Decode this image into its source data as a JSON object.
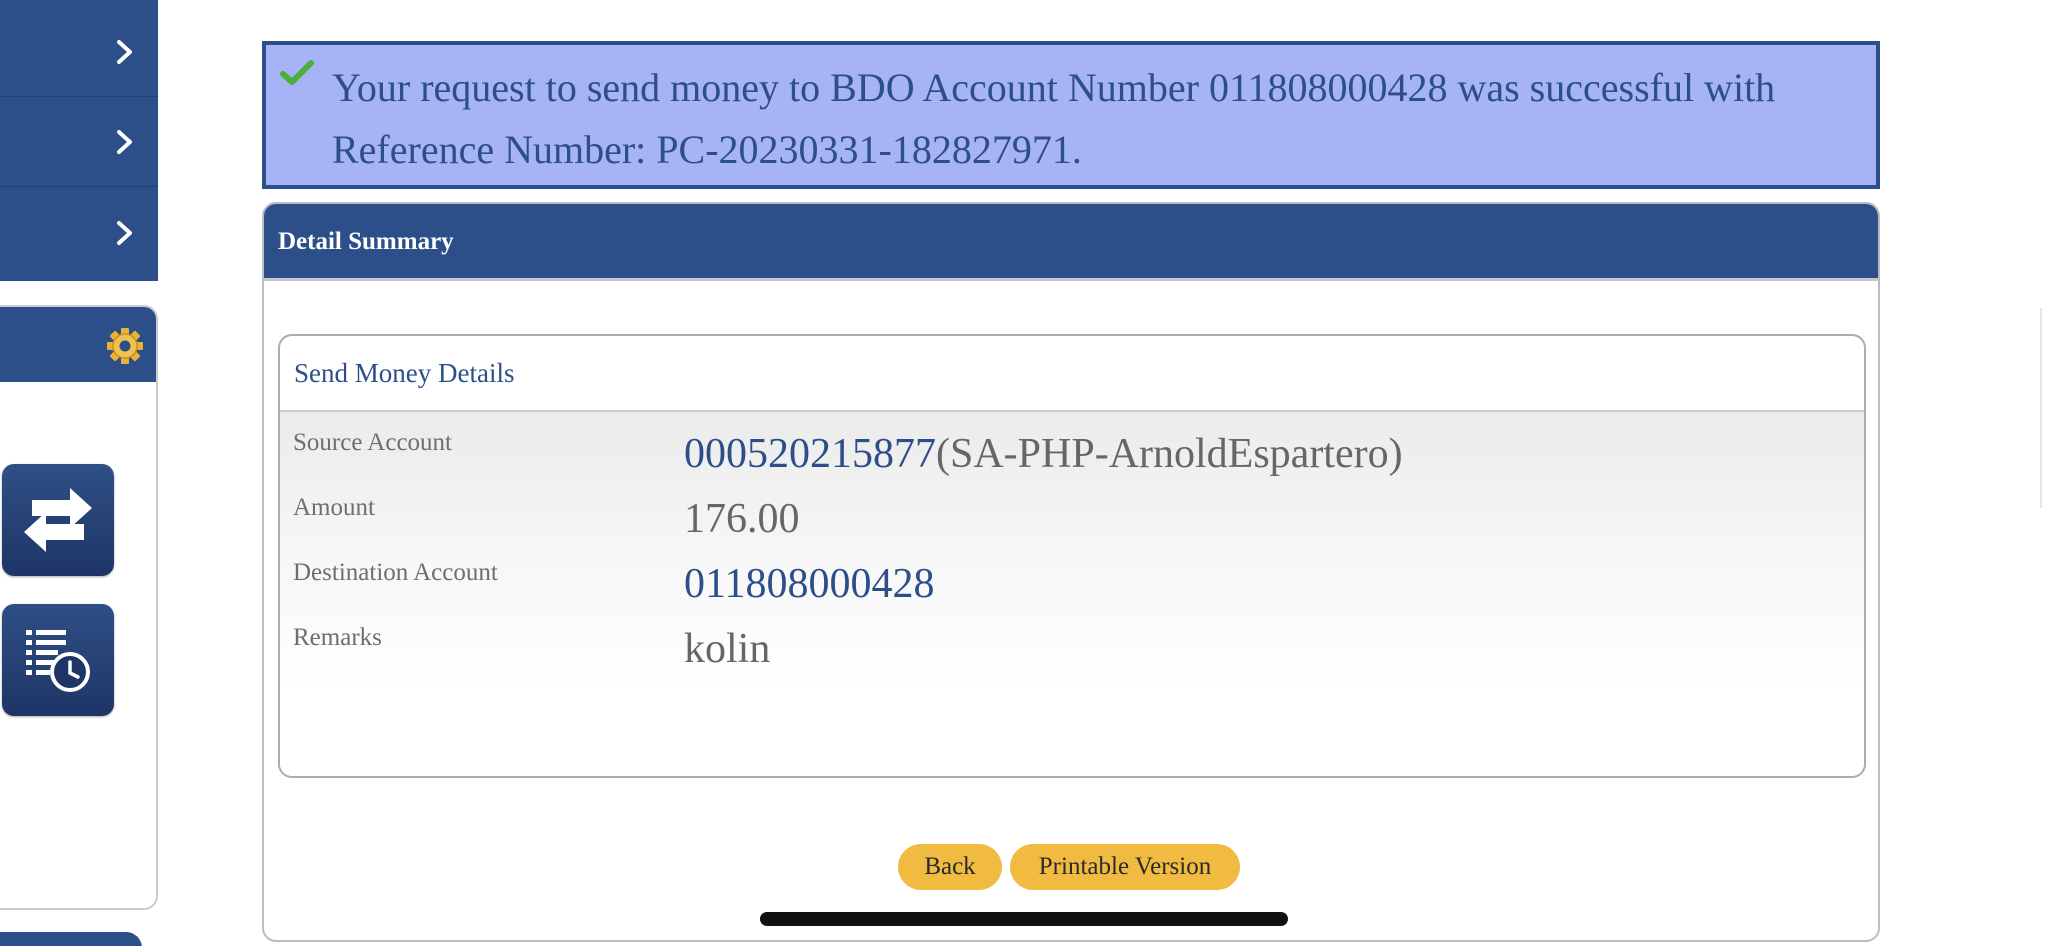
{
  "sidebar": {
    "nav_items": [
      {
        "icon": "chevron-right-icon"
      },
      {
        "icon": "chevron-right-icon"
      },
      {
        "icon": "chevron-right-icon"
      }
    ],
    "settings_icon": "gear-icon",
    "quick_actions": [
      {
        "icon": "transfer-arrows-icon"
      },
      {
        "icon": "transaction-history-icon"
      }
    ]
  },
  "banner": {
    "icon": "checkmark-icon",
    "message": "Your request to send money to BDO Account Number 011808000428 was successful with Reference Number: PC-20230331-182827971."
  },
  "summary": {
    "title": "Detail Summary",
    "section_title": "Send Money Details",
    "fields": {
      "source_account": {
        "label": "Source Account",
        "account_number": "000520215877",
        "account_name": "(SA-PHP-ArnoldEspartero)"
      },
      "amount": {
        "label": "Amount",
        "value": "176.00"
      },
      "destination_account": {
        "label": "Destination Account",
        "value": "011808000428"
      },
      "remarks": {
        "label": "Remarks",
        "value": "kolin"
      }
    }
  },
  "actions": {
    "back_label": "Back",
    "print_label": "Printable Version"
  },
  "colors": {
    "primary_navy": "#2c4f8a",
    "banner_bg": "#a7b3f7",
    "button_gold": "#f1bb42"
  }
}
